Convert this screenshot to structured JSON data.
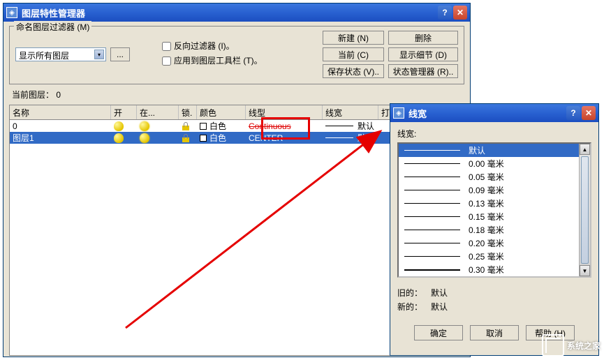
{
  "layer_mgr": {
    "title": "图层特性管理器",
    "filter_group": "命名图层过滤器 (M)",
    "filter_select": "显示所有图层",
    "filter_more": "...",
    "checkboxes": {
      "invert": "反向过滤器 (I)。",
      "apply_toolbar": "应用到图层工具栏 (T)。"
    },
    "buttons": {
      "new": "新建 (N)",
      "delete": "删除",
      "current": "当前 (C)",
      "details": "显示细节 (D)",
      "save_state": "保存状态 (V)..",
      "state_mgr": "状态管理器 (R).."
    },
    "current_layer": "当前图层：  0",
    "columns": {
      "name": "名称",
      "on": "开",
      "frozen": "在...",
      "lock": "锁.",
      "color": "颜色",
      "linetype": "线型",
      "lineweight": "线宽",
      "plot": "打"
    },
    "rows": [
      {
        "name": "0",
        "color": "白色",
        "linetype": "Continuous",
        "lineweight": "默认"
      },
      {
        "name": "图层1",
        "color": "白色",
        "linetype": "CENTER",
        "lineweight": "默认"
      }
    ]
  },
  "lw_dialog": {
    "title": "线宽",
    "label": "线宽:",
    "items": [
      "默认",
      "0.00 毫米",
      "0.05 毫米",
      "0.09 毫米",
      "0.13 毫米",
      "0.15 毫米",
      "0.18 毫米",
      "0.20 毫米",
      "0.25 毫米",
      "0.30 毫米"
    ],
    "old_label": "旧的：",
    "old_value": "默认",
    "new_label": "新的：",
    "new_value": "默认",
    "ok": "确定",
    "cancel": "取消",
    "help": "帮助 (H)"
  },
  "watermark": "系统之家"
}
